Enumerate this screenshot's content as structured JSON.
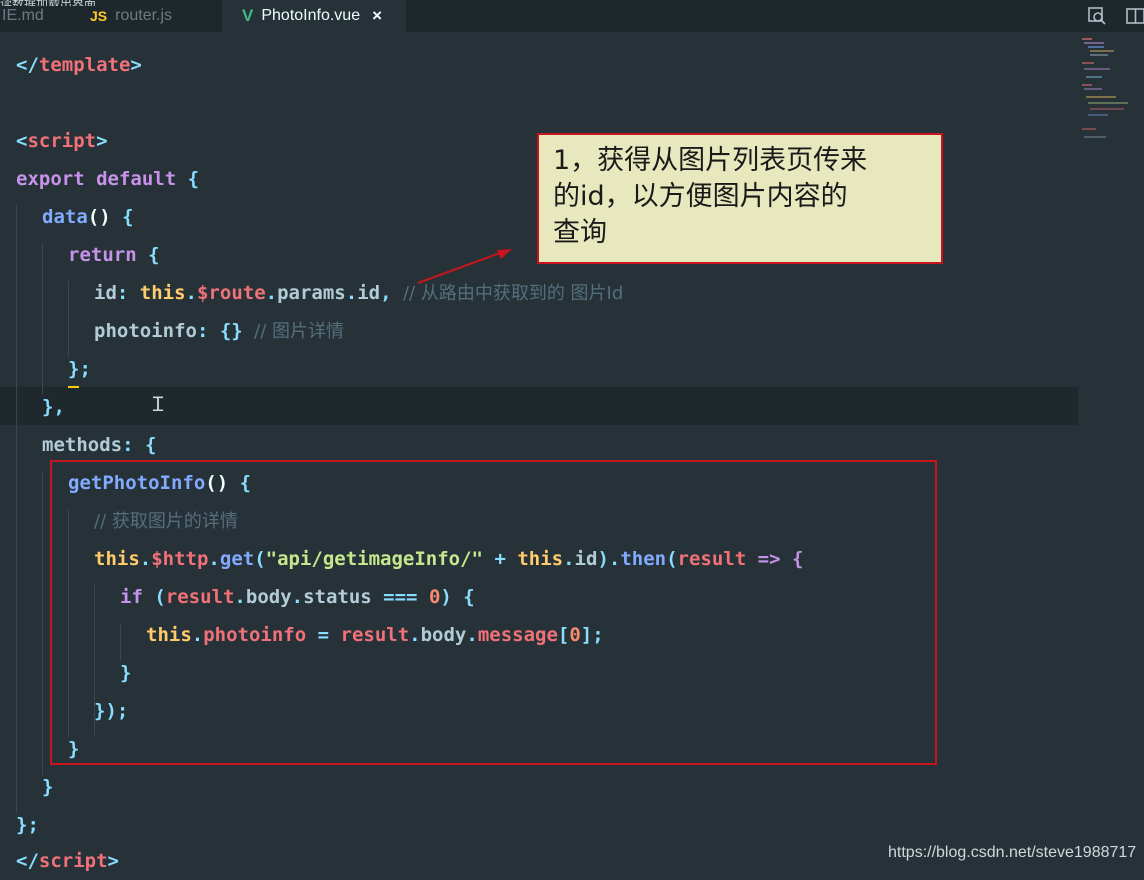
{
  "top_fragment": "读数据加载出界面",
  "tabs": [
    {
      "label": "IE.md",
      "icon": "markdown-file-icon",
      "active": false
    },
    {
      "label": "router.js",
      "icon_text": "JS",
      "active": false
    },
    {
      "label": "PhotoInfo.vue",
      "icon_text": "V",
      "active": true,
      "close": "×"
    }
  ],
  "toolbar_icons": [
    "open-changes-icon",
    "split-editor-icon"
  ],
  "code": {
    "l1": {
      "a": "</",
      "b": "template",
      "c": ">"
    },
    "l2": {
      "a": "<",
      "b": "script",
      "c": ">"
    },
    "l3": {
      "a": "export",
      "b": " ",
      "c": "default",
      "d": " {"
    },
    "l4": {
      "a": "data",
      "b": "()",
      "c": " {"
    },
    "l5": {
      "a": "return",
      "b": " {"
    },
    "l6": {
      "a": "id",
      "b": ": ",
      "c": "this",
      "d": ".",
      "e": "$route",
      "f": ".",
      "g": "params",
      "h": ".",
      "i": "id",
      "j": ", ",
      "k": "// 从路由中获取到的 图片Id"
    },
    "l7": {
      "a": "photoinfo",
      "b": ": {} ",
      "c": "// 图片详情"
    },
    "l8": {
      "a": "};"
    },
    "l9": {
      "a": "},"
    },
    "l10": {
      "a": "methods",
      "b": ": {"
    },
    "l11": {
      "a": "getPhotoInfo",
      "b": "()",
      "c": " {"
    },
    "l12": {
      "a": "// 获取图片的详情"
    },
    "l13": {
      "a": "this",
      "b": ".",
      "c": "$http",
      "d": ".",
      "e": "get",
      "f": "(",
      "g": "\"api/getimageInfo/\"",
      "h": " + ",
      "i": "this",
      "j": ".",
      "k": "id",
      "l": ").",
      "m": "then",
      "n": "(",
      "o": "result",
      "p": " => {"
    },
    "l14": {
      "a": "if",
      "b": " (",
      "c": "result",
      "d": ".",
      "e": "body",
      "f": ".",
      "g": "status",
      "h": " === ",
      "i": "0",
      "j": ") {"
    },
    "l15": {
      "a": "this",
      "b": ".",
      "c": "photoinfo",
      "d": " = ",
      "e": "result",
      "f": ".",
      "g": "body",
      "h": ".",
      "i": "message",
      "j": "[",
      "k": "0",
      "l": "];"
    },
    "l16": {
      "a": "}"
    },
    "l17": {
      "a": "});"
    },
    "l18": {
      "a": "}"
    },
    "l19": {
      "a": "}"
    },
    "l20": {
      "a": "};"
    },
    "l21": {
      "a": "</",
      "b": "script",
      "c": ">"
    }
  },
  "callout": {
    "line1": "1，获得从图片列表页传来",
    "line2": "的id，以方便图片内容的",
    "line3": "查询"
  },
  "watermark": "https://blog.csdn.net/steve1988717",
  "colors": {
    "background": "#263238",
    "tag": "#f07178",
    "keyword": "#c792ea",
    "function": "#82aaff",
    "this": "#ffcb6b",
    "string": "#c3e88d",
    "comment": "#546e7a",
    "annotation_border": "#c8141c",
    "callout_fill": "#e8e8bf"
  }
}
